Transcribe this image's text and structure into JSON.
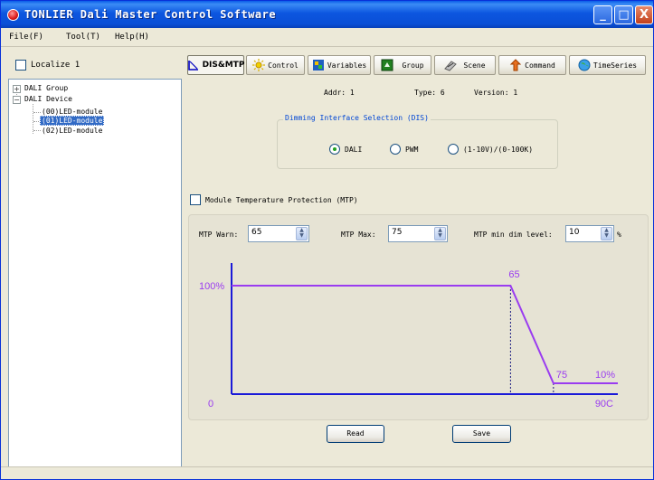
{
  "window": {
    "title": "TONLIER Dali Master Control Software",
    "minimize_glyph": "_",
    "maximize_glyph": "□",
    "close_glyph": "X"
  },
  "menu": {
    "items": [
      "File(F)",
      "Tool(T)",
      "Help(H)"
    ]
  },
  "sidebar": {
    "localize_label": "Localize 1",
    "localize_checked": false,
    "tree": {
      "group": {
        "label": "DALI Group",
        "toggle": "+"
      },
      "device": {
        "label": "DALI Device",
        "toggle": "−"
      },
      "modules": [
        "(00)LED-module",
        "(01)LED-module",
        "(02)LED-module"
      ],
      "selected_index": 1
    }
  },
  "tabs": [
    {
      "label": "DIS&MTP",
      "icon": "dis-mtp-icon",
      "active": true
    },
    {
      "label": "Control",
      "icon": "sun-icon"
    },
    {
      "label": "Variables",
      "icon": "variables-icon"
    },
    {
      "label": "Group",
      "icon": "group-icon"
    },
    {
      "label": "Scene",
      "icon": "scene-icon"
    },
    {
      "label": "Command",
      "icon": "command-icon"
    },
    {
      "label": "TimeSeries",
      "icon": "globe-icon"
    }
  ],
  "device_info": {
    "addr": "Addr: 1",
    "type": "Type: 6",
    "version": "Version: 1"
  },
  "dis": {
    "title": "Dimming Interface Selection (DIS)",
    "options": [
      "DALI",
      "PWM",
      "(1-10V)/(0-100K)"
    ],
    "selected": "DALI"
  },
  "mtp": {
    "checkbox_label": "Module Temperature Protection (MTP)",
    "checked": false,
    "warn_label": "MTP Warn:",
    "warn_value": "65",
    "max_label": "MTP Max:",
    "max_value": "75",
    "min_dim_label": "MTP min dim level:",
    "min_dim_value": "10",
    "percent_sign": "%"
  },
  "chart_data": {
    "type": "line",
    "labels": {
      "y_top": "100%",
      "origin": "0",
      "warn": "65",
      "max": "75",
      "min_level": "10%",
      "x_end": "90C"
    },
    "points": [
      {
        "x": 0,
        "y": 100
      },
      {
        "x": 65,
        "y": 100
      },
      {
        "x": 75,
        "y": 10
      },
      {
        "x": 90,
        "y": 10
      }
    ],
    "xlim": [
      0,
      90
    ],
    "ylim": [
      0,
      100
    ],
    "line_color": "#9a3cf0",
    "axis_color": "#1a1ad8"
  },
  "buttons": {
    "read": "Read",
    "save": "Save"
  },
  "colors": {
    "titlebar": "#0a4fd6",
    "selection": "#316ac5",
    "group_title": "#0046d5"
  }
}
